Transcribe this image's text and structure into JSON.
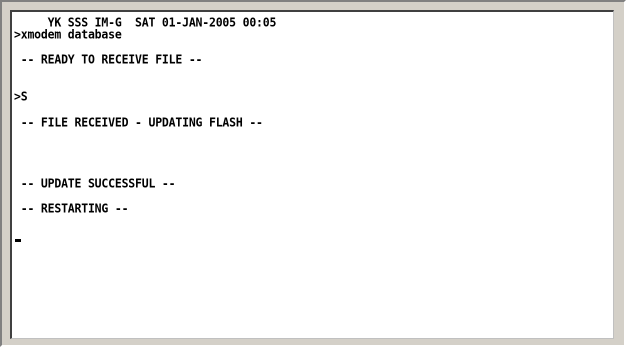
{
  "terminal": {
    "lines": [
      "     YK SSS IM-G  SAT 01-JAN-2005 00:05",
      ">xmodem database",
      " -- READY TO RECEIVE FILE --",
      ">S",
      " -- FILE RECEIVED - UPDATING FLASH --",
      " -- UPDATE SUCCESSFUL --",
      " -- RESTARTING --"
    ]
  },
  "colors": {
    "background": "#ffffff",
    "text": "#000000",
    "frame": "#d4d0c8"
  }
}
